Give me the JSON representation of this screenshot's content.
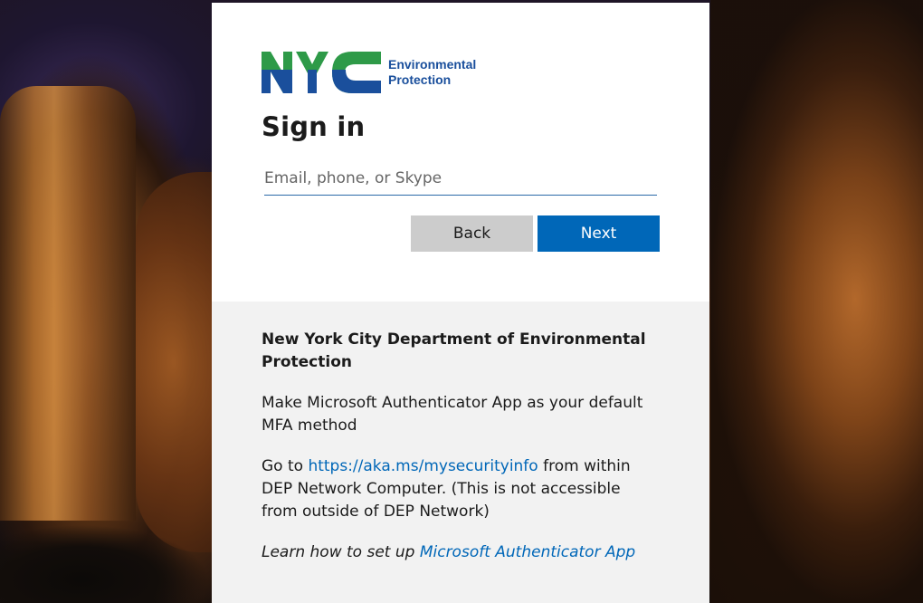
{
  "logo": {
    "mark_text": "NYC",
    "line1": "Environmental",
    "line2": "Protection",
    "colors": {
      "green": "#2e9a48",
      "blue": "#1a4f9c"
    }
  },
  "signin": {
    "title": "Sign in",
    "email_placeholder": "Email, phone, or Skype",
    "email_value": "",
    "back_label": "Back",
    "next_label": "Next"
  },
  "notice": {
    "org_name": "New York City Department of Environmental Protection",
    "mfa_text": "Make Microsoft Authenticator App as your default MFA method",
    "goto_prefix": "Go to ",
    "goto_link": "https://aka.ms/mysecurityinfo",
    "goto_suffix": " from within DEP Network Computer. (This is not accessible from outside of DEP Network)",
    "learn_prefix": "Learn how to set up ",
    "learn_link": "Microsoft Authenticator App"
  },
  "colors": {
    "accent": "#0067b8",
    "back_button": "#cccccc",
    "footer_bg": "#f2f2f2"
  }
}
